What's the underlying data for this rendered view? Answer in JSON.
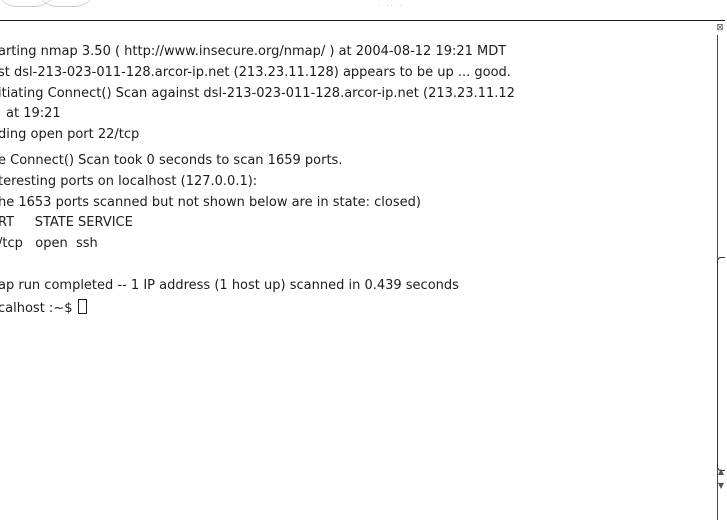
{
  "terminal": {
    "lines": [
      "arting nmap 3.50 ( http://www.insecure.org/nmap/ ) at 2004-08-12 19:21 MDT",
      "st dsl-213-023-011-128.arcor-ip.net (213.23.11.128) appears to be up ... good.",
      "itiating Connect() Scan against dsl-213-023-011-128.arcor-ip.net (213.23.11.12",
      "at 19:21",
      "ding open port 22/tcp",
      "e Connect() Scan took 0 seconds to scan 1659 ports.",
      "teresting ports on localhost (127.0.0.1):",
      "he 1653 ports scanned but not shown below are in state: closed)",
      "RT     STATE SERVICE",
      "/tcp   open  ssh",
      "",
      "ap run completed -- 1 IP address (1 host up) scanned in 0.439 seconds",
      "calhost :~$"
    ],
    "cursor": "cursor-block"
  },
  "scrollbar": {
    "top_icon": "close-icon",
    "up_icon": "arrow-up-icon",
    "down_icon": "arrow-down-icon"
  }
}
